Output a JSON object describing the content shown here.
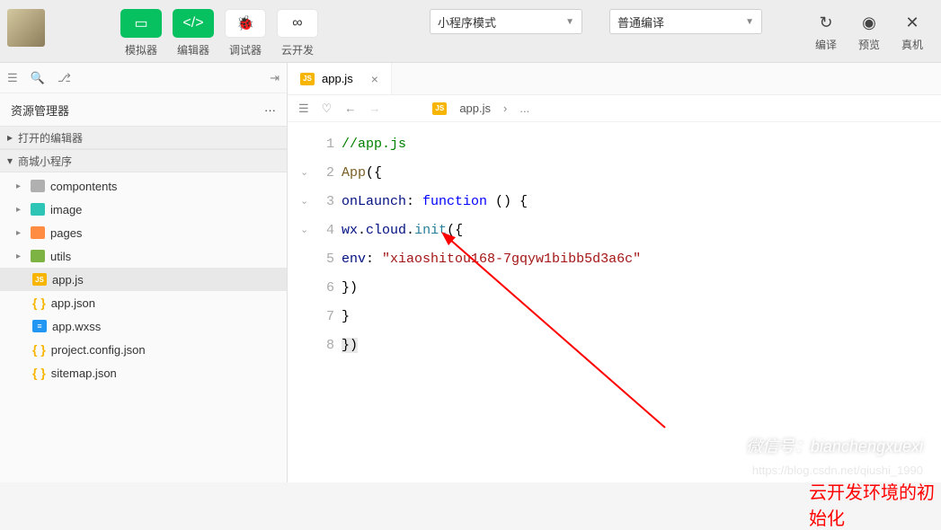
{
  "toolbar": {
    "simulator": "模拟器",
    "editor": "编辑器",
    "debugger": "调试器",
    "cloud": "云开发",
    "mode": "小程序模式",
    "compile_mode": "普通编译",
    "compile": "编译",
    "preview": "预览",
    "real": "真机"
  },
  "sidebar": {
    "title": "资源管理器",
    "open_editors": "打开的编辑器",
    "project": "商城小程序",
    "tree": {
      "compontents": "compontents",
      "image": "image",
      "pages": "pages",
      "utils": "utils",
      "app_js": "app.js",
      "app_json": "app.json",
      "app_wxss": "app.wxss",
      "project_config": "project.config.json",
      "sitemap": "sitemap.json"
    }
  },
  "tabs": {
    "active": "app.js"
  },
  "breadcrumb": {
    "file": "app.js",
    "sep": "›",
    "rest": "..."
  },
  "code": {
    "l1": "//app.js",
    "l2_fn": "App",
    "l2_rest": "({",
    "l3_prop": "onLaunch",
    "l3_kw": "function",
    "l3_rest": " () {",
    "l4_a": "wx",
    "l4_b": "cloud",
    "l4_c": "init",
    "l4_d": "({",
    "l5_prop": "env",
    "l5_str": "\"xiaoshitou168-7gqyw1bibb5d3a6c\"",
    "l6": "})",
    "l7": "}",
    "l8": "})"
  },
  "annotation": "云开发环境的初始化",
  "watermark": "微信号：bianchengxuexi",
  "watermark2": "https://blog.csdn.net/qiushi_1990",
  "chart_data": null
}
